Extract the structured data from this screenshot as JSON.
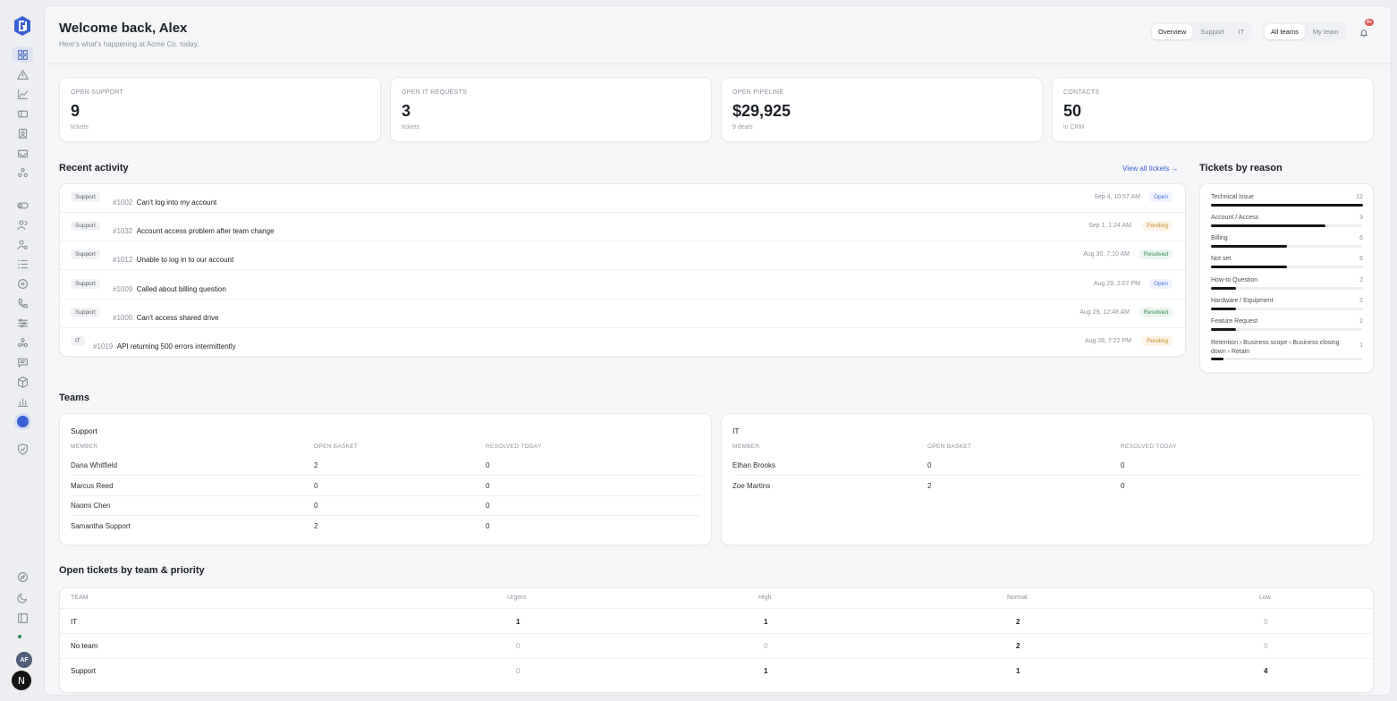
{
  "header": {
    "title": "Welcome back, Alex",
    "subtitle": "Here's what's happening at Acme Co. today.",
    "view_tabs": [
      "Overview",
      "Support",
      "IT"
    ],
    "scope_tabs": [
      "All teams",
      "My team"
    ],
    "notification_badge": "9+"
  },
  "stats": [
    {
      "label": "OPEN SUPPORT",
      "value": "9",
      "unit": "tickets"
    },
    {
      "label": "OPEN IT REQUESTS",
      "value": "3",
      "unit": "tickets"
    },
    {
      "label": "OPEN PIPELINE",
      "value": "$29,925",
      "unit": "9 deals"
    },
    {
      "label": "CONTACTS",
      "value": "50",
      "unit": "in CRM"
    }
  ],
  "activity": {
    "title": "Recent activity",
    "view_all": "View all tickets →",
    "items": [
      {
        "tag": "Support",
        "num": "#1002",
        "title": "Can't log into my account",
        "date": "Sep 4, 10:57 AM",
        "status": "Open",
        "kind": "open"
      },
      {
        "tag": "Support",
        "num": "#1032",
        "title": "Account access problem after team change",
        "date": "Sep 1, 1:24 AM",
        "status": "Pending",
        "kind": "pending"
      },
      {
        "tag": "Support",
        "num": "#1012",
        "title": "Unable to log in to our account",
        "date": "Aug 30, 7:10 AM",
        "status": "Resolved",
        "kind": "resolved"
      },
      {
        "tag": "Support",
        "num": "#1009",
        "title": "Called about billing question",
        "date": "Aug 29, 2:07 PM",
        "status": "Open",
        "kind": "open"
      },
      {
        "tag": "Support",
        "num": "#1000",
        "title": "Can't access shared drive",
        "date": "Aug 29, 12:48 AM",
        "status": "Resolved",
        "kind": "resolved"
      },
      {
        "tag": "IT",
        "num": "#1019",
        "title": "API returning 500 errors intermittently",
        "date": "Aug 28, 7:22 PM",
        "status": "Pending",
        "kind": "pending"
      }
    ]
  },
  "reasons": {
    "title": "Tickets by reason",
    "items": [
      {
        "name": "Technical Issue",
        "count": "12",
        "fraction": 1.0
      },
      {
        "name": "Account / Access",
        "count": "9",
        "fraction": 0.75
      },
      {
        "name": "Billing",
        "count": "6",
        "fraction": 0.5
      },
      {
        "name": "Not set",
        "count": "6",
        "fraction": 0.5
      },
      {
        "name": "How-to Question",
        "count": "2",
        "fraction": 0.167
      },
      {
        "name": "Hardware / Equipment",
        "count": "2",
        "fraction": 0.167
      },
      {
        "name": "Feature Request",
        "count": "2",
        "fraction": 0.167
      },
      {
        "name": "Retention › Business scope › Business closing down › Retain",
        "count": "1",
        "fraction": 0.083
      }
    ]
  },
  "teams": {
    "title": "Teams",
    "columns": [
      "MEMBER",
      "OPEN BASKET",
      "RESOLVED TODAY"
    ],
    "groups": [
      {
        "name": "Support",
        "rows": [
          [
            "Dana Whitfield",
            "2",
            "0"
          ],
          [
            "Marcus Reed",
            "0",
            "0"
          ],
          [
            "Naomi Chen",
            "0",
            "0"
          ],
          [
            "Samantha Support",
            "2",
            "0"
          ]
        ]
      },
      {
        "name": "IT",
        "rows": [
          [
            "Ethan Brooks",
            "0",
            "0"
          ],
          [
            "Zoe Martins",
            "2",
            "0"
          ]
        ]
      }
    ]
  },
  "priority": {
    "title": "Open tickets by team & priority",
    "columns": [
      "TEAM",
      "Urgent",
      "High",
      "Normal",
      "Low"
    ],
    "rows": [
      [
        "IT",
        "1",
        "1",
        "2",
        "0"
      ],
      [
        "No team",
        "0",
        "0",
        "2",
        "0"
      ],
      [
        "Support",
        "0",
        "1",
        "1",
        "4"
      ]
    ]
  },
  "user": {
    "initials": "AF"
  },
  "colors": {
    "accent": "#3b5fd6",
    "open": "#4b6fd6",
    "pending": "#c98a2b",
    "resolved": "#2f8a57"
  }
}
